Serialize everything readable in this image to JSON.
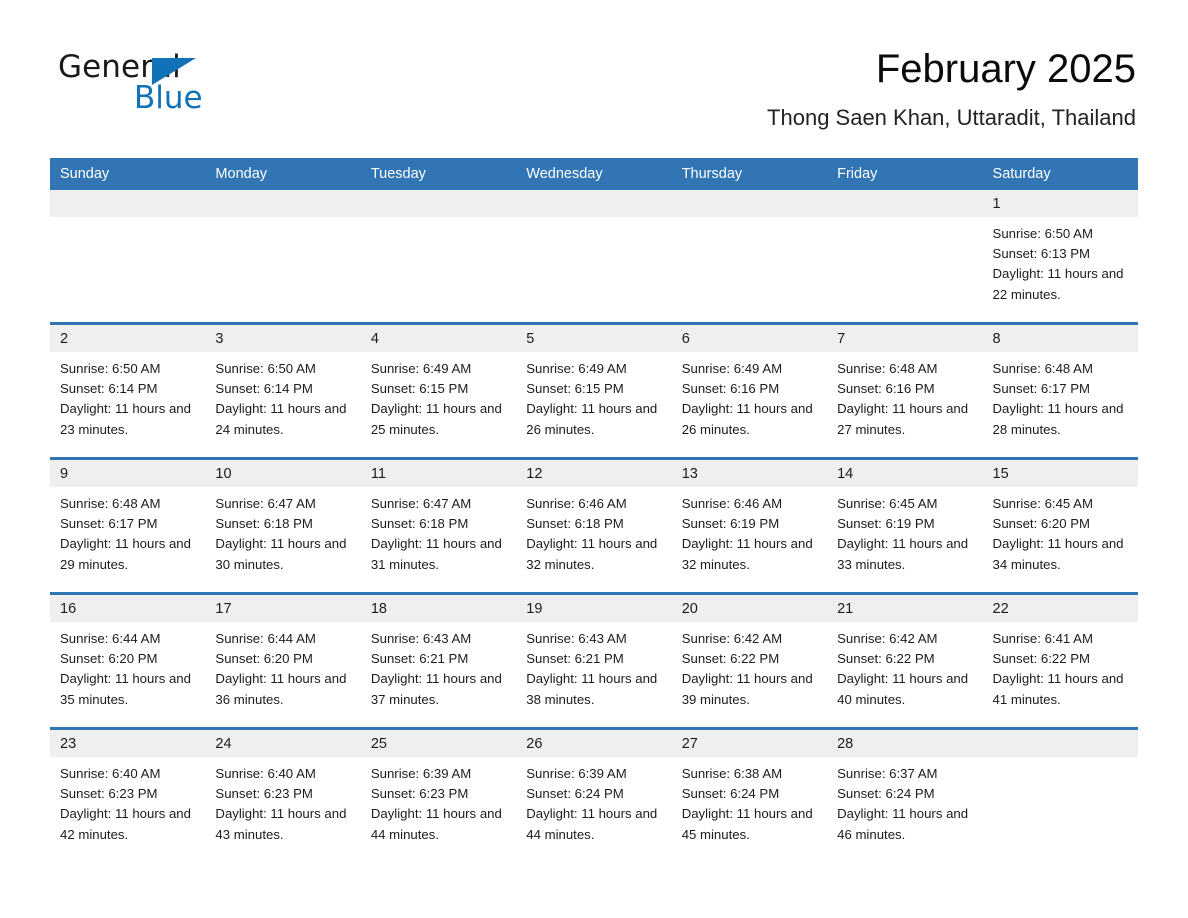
{
  "brand": {
    "word1": "General",
    "word2": "Blue",
    "triangle_color": "#1272b8",
    "triangle_name": "general-blue-triangle-icon"
  },
  "header": {
    "title": "February 2025",
    "subtitle": "Thong Saen Khan, Uttaradit, Thailand"
  },
  "colors": {
    "header_blue": "#3175b4",
    "row_divider_blue": "#3175b4",
    "daynum_band": "#efefef",
    "brand_blue": "#1272b8",
    "text": "#1c1c1c"
  },
  "weekday_headers": [
    "Sunday",
    "Monday",
    "Tuesday",
    "Wednesday",
    "Thursday",
    "Friday",
    "Saturday"
  ],
  "labels": {
    "sunrise_prefix": "Sunrise:",
    "sunset_prefix": "Sunset:",
    "daylight_prefix": "Daylight:"
  },
  "weeks": [
    [
      {
        "day": "",
        "blank": true
      },
      {
        "day": "",
        "blank": true
      },
      {
        "day": "",
        "blank": true
      },
      {
        "day": "",
        "blank": true
      },
      {
        "day": "",
        "blank": true
      },
      {
        "day": "",
        "blank": true
      },
      {
        "day": "1",
        "sunrise": "Sunrise: 6:50 AM",
        "sunset": "Sunset: 6:13 PM",
        "daylight": "Daylight: 11 hours and 22 minutes."
      }
    ],
    [
      {
        "day": "2",
        "sunrise": "Sunrise: 6:50 AM",
        "sunset": "Sunset: 6:14 PM",
        "daylight": "Daylight: 11 hours and 23 minutes."
      },
      {
        "day": "3",
        "sunrise": "Sunrise: 6:50 AM",
        "sunset": "Sunset: 6:14 PM",
        "daylight": "Daylight: 11 hours and 24 minutes."
      },
      {
        "day": "4",
        "sunrise": "Sunrise: 6:49 AM",
        "sunset": "Sunset: 6:15 PM",
        "daylight": "Daylight: 11 hours and 25 minutes."
      },
      {
        "day": "5",
        "sunrise": "Sunrise: 6:49 AM",
        "sunset": "Sunset: 6:15 PM",
        "daylight": "Daylight: 11 hours and 26 minutes."
      },
      {
        "day": "6",
        "sunrise": "Sunrise: 6:49 AM",
        "sunset": "Sunset: 6:16 PM",
        "daylight": "Daylight: 11 hours and 26 minutes."
      },
      {
        "day": "7",
        "sunrise": "Sunrise: 6:48 AM",
        "sunset": "Sunset: 6:16 PM",
        "daylight": "Daylight: 11 hours and 27 minutes."
      },
      {
        "day": "8",
        "sunrise": "Sunrise: 6:48 AM",
        "sunset": "Sunset: 6:17 PM",
        "daylight": "Daylight: 11 hours and 28 minutes."
      }
    ],
    [
      {
        "day": "9",
        "sunrise": "Sunrise: 6:48 AM",
        "sunset": "Sunset: 6:17 PM",
        "daylight": "Daylight: 11 hours and 29 minutes."
      },
      {
        "day": "10",
        "sunrise": "Sunrise: 6:47 AM",
        "sunset": "Sunset: 6:18 PM",
        "daylight": "Daylight: 11 hours and 30 minutes."
      },
      {
        "day": "11",
        "sunrise": "Sunrise: 6:47 AM",
        "sunset": "Sunset: 6:18 PM",
        "daylight": "Daylight: 11 hours and 31 minutes."
      },
      {
        "day": "12",
        "sunrise": "Sunrise: 6:46 AM",
        "sunset": "Sunset: 6:18 PM",
        "daylight": "Daylight: 11 hours and 32 minutes."
      },
      {
        "day": "13",
        "sunrise": "Sunrise: 6:46 AM",
        "sunset": "Sunset: 6:19 PM",
        "daylight": "Daylight: 11 hours and 32 minutes."
      },
      {
        "day": "14",
        "sunrise": "Sunrise: 6:45 AM",
        "sunset": "Sunset: 6:19 PM",
        "daylight": "Daylight: 11 hours and 33 minutes."
      },
      {
        "day": "15",
        "sunrise": "Sunrise: 6:45 AM",
        "sunset": "Sunset: 6:20 PM",
        "daylight": "Daylight: 11 hours and 34 minutes."
      }
    ],
    [
      {
        "day": "16",
        "sunrise": "Sunrise: 6:44 AM",
        "sunset": "Sunset: 6:20 PM",
        "daylight": "Daylight: 11 hours and 35 minutes."
      },
      {
        "day": "17",
        "sunrise": "Sunrise: 6:44 AM",
        "sunset": "Sunset: 6:20 PM",
        "daylight": "Daylight: 11 hours and 36 minutes."
      },
      {
        "day": "18",
        "sunrise": "Sunrise: 6:43 AM",
        "sunset": "Sunset: 6:21 PM",
        "daylight": "Daylight: 11 hours and 37 minutes."
      },
      {
        "day": "19",
        "sunrise": "Sunrise: 6:43 AM",
        "sunset": "Sunset: 6:21 PM",
        "daylight": "Daylight: 11 hours and 38 minutes."
      },
      {
        "day": "20",
        "sunrise": "Sunrise: 6:42 AM",
        "sunset": "Sunset: 6:22 PM",
        "daylight": "Daylight: 11 hours and 39 minutes."
      },
      {
        "day": "21",
        "sunrise": "Sunrise: 6:42 AM",
        "sunset": "Sunset: 6:22 PM",
        "daylight": "Daylight: 11 hours and 40 minutes."
      },
      {
        "day": "22",
        "sunrise": "Sunrise: 6:41 AM",
        "sunset": "Sunset: 6:22 PM",
        "daylight": "Daylight: 11 hours and 41 minutes."
      }
    ],
    [
      {
        "day": "23",
        "sunrise": "Sunrise: 6:40 AM",
        "sunset": "Sunset: 6:23 PM",
        "daylight": "Daylight: 11 hours and 42 minutes."
      },
      {
        "day": "24",
        "sunrise": "Sunrise: 6:40 AM",
        "sunset": "Sunset: 6:23 PM",
        "daylight": "Daylight: 11 hours and 43 minutes."
      },
      {
        "day": "25",
        "sunrise": "Sunrise: 6:39 AM",
        "sunset": "Sunset: 6:23 PM",
        "daylight": "Daylight: 11 hours and 44 minutes."
      },
      {
        "day": "26",
        "sunrise": "Sunrise: 6:39 AM",
        "sunset": "Sunset: 6:24 PM",
        "daylight": "Daylight: 11 hours and 44 minutes."
      },
      {
        "day": "27",
        "sunrise": "Sunrise: 6:38 AM",
        "sunset": "Sunset: 6:24 PM",
        "daylight": "Daylight: 11 hours and 45 minutes."
      },
      {
        "day": "28",
        "sunrise": "Sunrise: 6:37 AM",
        "sunset": "Sunset: 6:24 PM",
        "daylight": "Daylight: 11 hours and 46 minutes."
      },
      {
        "day": "",
        "blank": true
      }
    ]
  ]
}
